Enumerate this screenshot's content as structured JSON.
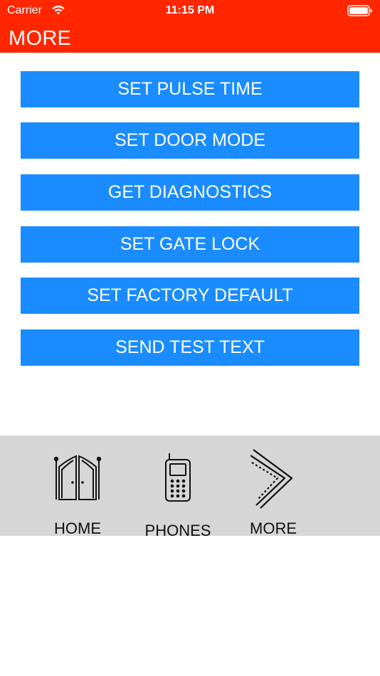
{
  "status_bar": {
    "carrier": "Carrier",
    "time": "11:15 PM"
  },
  "header": {
    "title": "MORE",
    "color": "#ff2600"
  },
  "actions": [
    {
      "label": "SET PULSE TIME"
    },
    {
      "label": "SET DOOR MODE"
    },
    {
      "label": "GET DIAGNOSTICS"
    },
    {
      "label": "SET GATE LOCK"
    },
    {
      "label": "SET FACTORY DEFAULT"
    },
    {
      "label": "SEND TEST TEXT"
    }
  ],
  "button_color": "#1a8cff",
  "tabs": [
    {
      "label": "HOME",
      "icon": "saloon-doors-icon"
    },
    {
      "label": "PHONES",
      "icon": "mobile-phone-icon"
    },
    {
      "label": "MORE",
      "icon": "chevron-right-icon"
    }
  ]
}
